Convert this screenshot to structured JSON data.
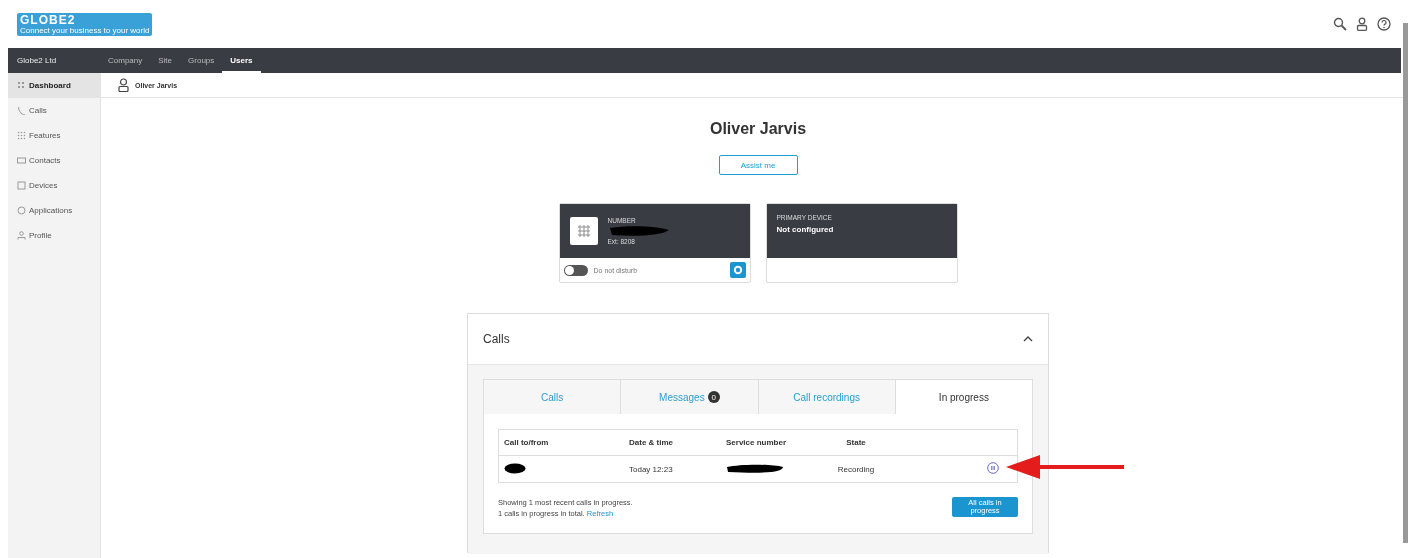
{
  "logo": {
    "text": "GLOBE2",
    "tagline": "Connect your business to your world"
  },
  "topbar": {
    "company": "Globe2 Ltd",
    "tabs": [
      {
        "label": "Company",
        "selected": false
      },
      {
        "label": "Site",
        "selected": false
      },
      {
        "label": "Groups",
        "selected": false
      },
      {
        "label": "Users",
        "selected": true
      }
    ]
  },
  "sidebar": {
    "items": [
      {
        "label": "Dashboard",
        "selected": true
      },
      {
        "label": "Calls",
        "selected": false
      },
      {
        "label": "Features",
        "selected": false
      },
      {
        "label": "Contacts",
        "selected": false
      },
      {
        "label": "Devices",
        "selected": false
      },
      {
        "label": "Applications",
        "selected": false
      },
      {
        "label": "Profile",
        "selected": false
      }
    ]
  },
  "breadcrumb": "Oliver Jarvis",
  "user": {
    "name": "Oliver Jarvis",
    "assist_button": "Assist me"
  },
  "number_card": {
    "label": "NUMBER",
    "ext": "Ext: 8208",
    "dnd_label": "Do not disturb",
    "dnd_on": false
  },
  "device_card": {
    "label": "PRIMARY DEVICE",
    "value": "Not configured"
  },
  "calls_panel": {
    "title": "Calls",
    "expanded": true,
    "tabs": [
      {
        "label": "Calls",
        "selected": false
      },
      {
        "label": "Messages",
        "badge": "0",
        "selected": false
      },
      {
        "label": "Call recordings",
        "selected": false
      },
      {
        "label": "In progress",
        "selected": true
      }
    ],
    "table": {
      "columns": [
        "Call to/from",
        "Date & time",
        "Service number",
        "State"
      ],
      "rows": [
        {
          "date_time": "Today 12:23",
          "state": "Recording"
        }
      ]
    },
    "summary": "Showing 1 most recent calls in progress.",
    "total": "1 calls in progress in total.",
    "refresh": "Refresh",
    "all_button": "All calls in progress"
  }
}
